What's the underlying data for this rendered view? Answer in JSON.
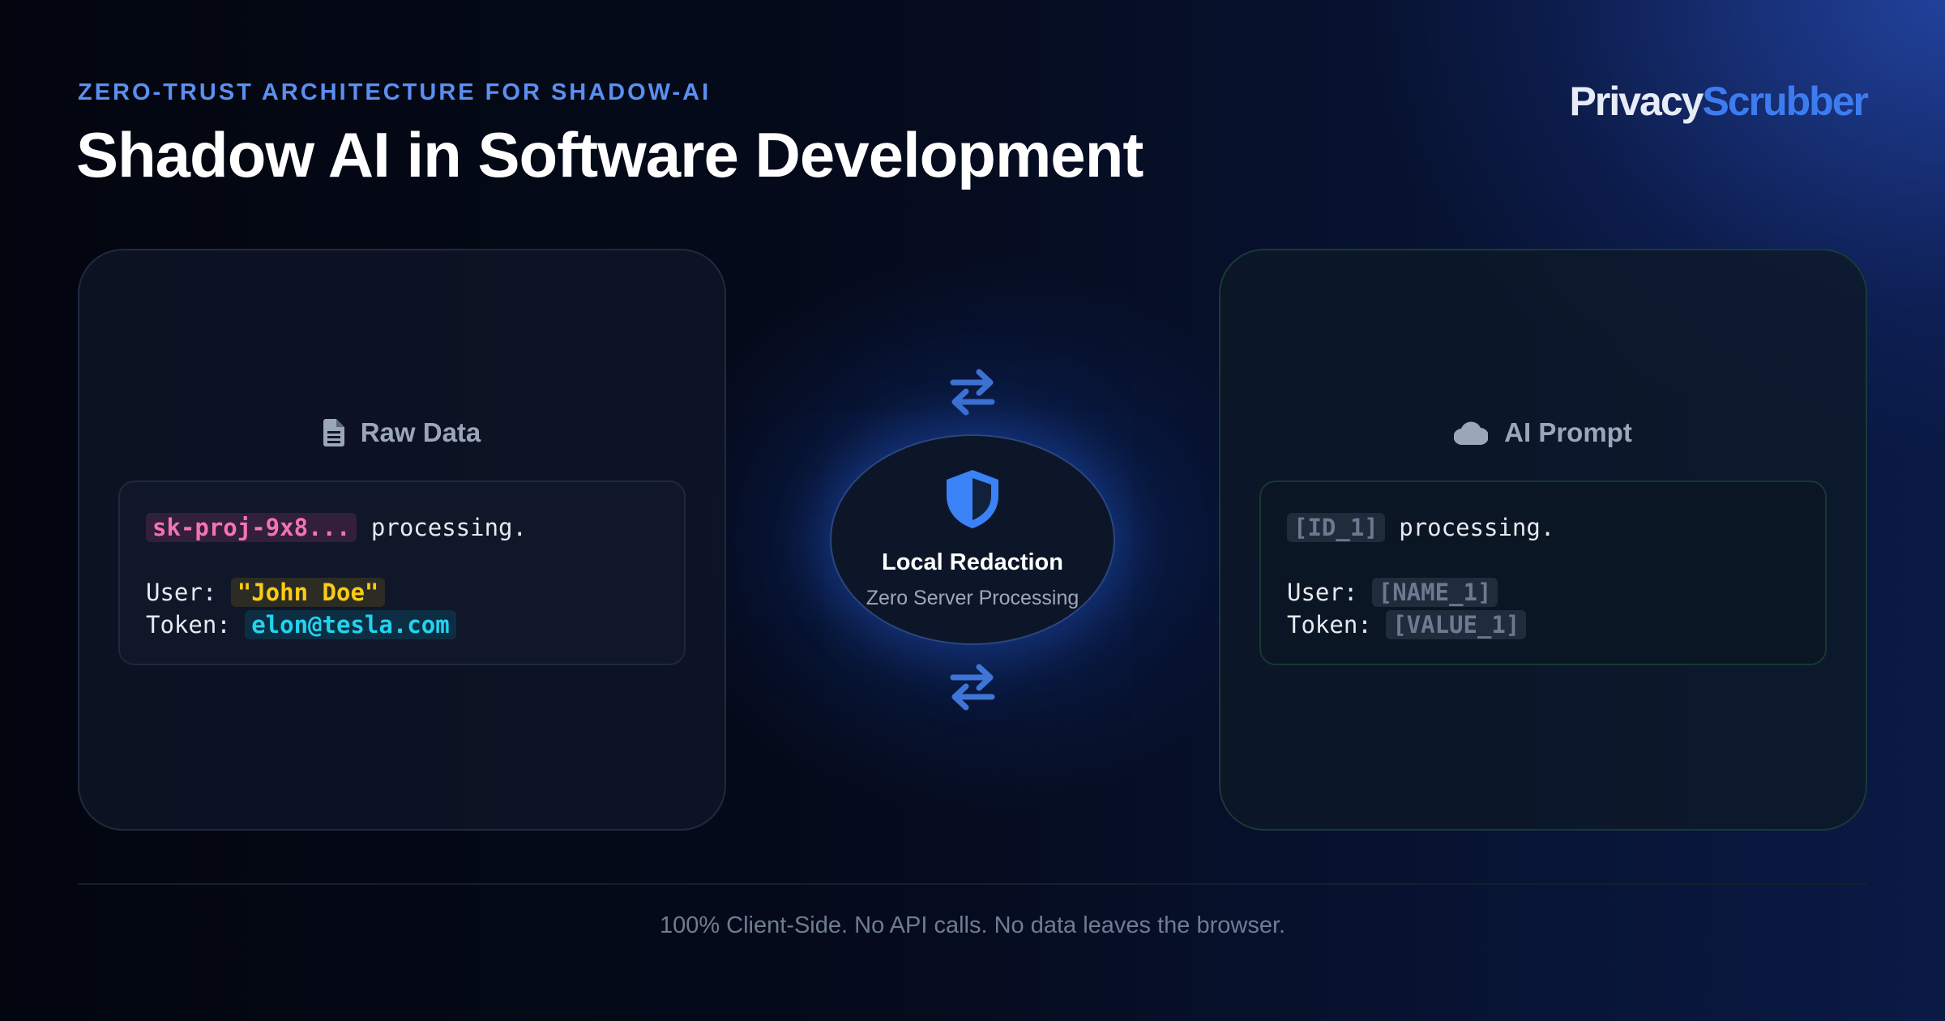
{
  "header": {
    "eyebrow": "ZERO-TRUST ARCHITECTURE FOR SHADOW-AI",
    "title": "Shadow AI in Software Development",
    "brand_part1": "Privacy",
    "brand_part2": "Scrubber"
  },
  "raw_card": {
    "icon": "document-icon",
    "title": "Raw Data",
    "line1_token": "sk-proj-9x8...",
    "line1_text": " processing.",
    "line2_label": "User: ",
    "line2_token": "\"John Doe\"",
    "line3_label": "Token: ",
    "line3_token": "elon@tesla.com"
  },
  "center": {
    "icon": "shield-icon",
    "title": "Local Redaction",
    "subtitle": "Zero Server Processing",
    "arrows_icon": "swap-arrows-icon"
  },
  "ai_card": {
    "icon": "cloud-icon",
    "title": "AI Prompt",
    "line1_token": "[ID_1]",
    "line1_text": " processing.",
    "line2_label": "User: ",
    "line2_token": "[NAME_1]",
    "line3_label": "Token: ",
    "line3_token": "[VALUE_1]"
  },
  "footer": {
    "text": "100% Client-Side. No API calls. No data leaves the browser."
  },
  "colors": {
    "accent": "#3d7cf0",
    "eyebrow": "#5b8ff0",
    "secret_token": "#f472b6",
    "name_token": "#facc15",
    "email_token": "#22d3ee",
    "placeholder_token": "#6b7a90"
  }
}
